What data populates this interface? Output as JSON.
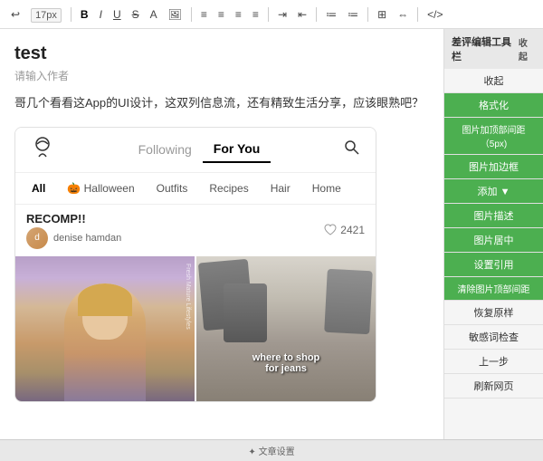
{
  "toolbar": {
    "size": "17px",
    "buttons": [
      "B",
      "I",
      "U",
      "S",
      "A"
    ],
    "icons": [
      "align-left",
      "align-center",
      "align-right",
      "align-justify",
      "indent",
      "outdent",
      "list",
      "ordered-list",
      "table",
      "link",
      "code"
    ]
  },
  "content": {
    "title": "test",
    "subtitle": "请输入作者",
    "description": "哥几个看看这App的UI设计，这双列信息流，还有精致生活分享，应该眼熟吧？"
  },
  "app": {
    "nav": {
      "following_label": "Following",
      "for_you_label": "For You"
    },
    "categories": [
      {
        "label": "All",
        "active": true
      },
      {
        "label": "🎃 Halloween",
        "active": false
      },
      {
        "label": "Outfits",
        "active": false
      },
      {
        "label": "Recipes",
        "active": false
      },
      {
        "label": "Hair",
        "active": false
      },
      {
        "label": "Home",
        "active": false
      }
    ],
    "recomp": {
      "label": "RECOMP!!",
      "user": "denise hamdan",
      "likes": "2421"
    },
    "left_image_overlay": "Fresh Mature Lifestyles",
    "right_image_text_line1": "where to shop",
    "right_image_text_line2": "for jeans"
  },
  "sidebar": {
    "header_label": "差评编辑工具栏",
    "collapse_label": "收起",
    "buttons": [
      {
        "label": "格式化",
        "style": "green"
      },
      {
        "label": "图片加顶部间距（5px)",
        "style": "green"
      },
      {
        "label": "图片加边框",
        "style": "green"
      },
      {
        "label": "添加 ▼",
        "style": "green"
      },
      {
        "label": "图片描述",
        "style": "green"
      },
      {
        "label": "图片居中",
        "style": "green"
      },
      {
        "label": "设置引用",
        "style": "green"
      },
      {
        "label": "清除图片顶部间距",
        "style": "green"
      },
      {
        "label": "恢复原样",
        "style": "plain"
      },
      {
        "label": "敏感词检查",
        "style": "plain"
      },
      {
        "label": "上一步",
        "style": "plain"
      },
      {
        "label": "刷新网页",
        "style": "plain"
      }
    ],
    "bottom_label": "✦ 文章设置"
  }
}
